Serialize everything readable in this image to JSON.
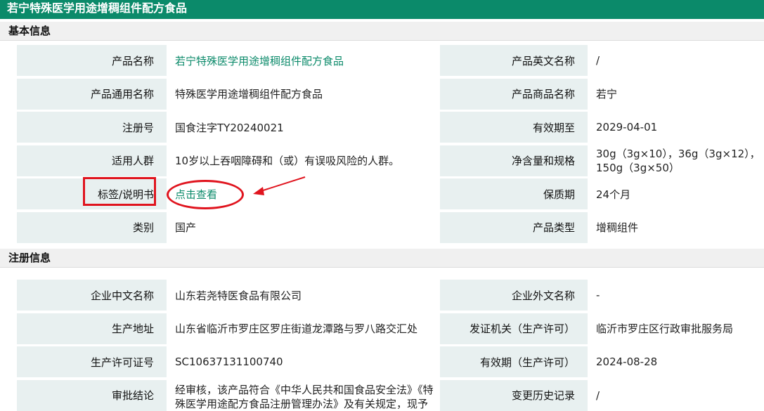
{
  "page_title": "若宁特殊医学用途增稠组件配方食品",
  "sections": {
    "basic": "基本信息",
    "registration": "注册信息"
  },
  "basic_info": {
    "product_name_label": "产品名称",
    "product_name": "若宁特殊医学用途增稠组件配方食品",
    "english_name_label": "产品英文名称",
    "english_name": "/",
    "generic_name_label": "产品通用名称",
    "generic_name": "特殊医学用途增稠组件配方食品",
    "brand_name_label": "产品商品名称",
    "brand_name": "若宁",
    "reg_no_label": "注册号",
    "reg_no": "国食注字TY20240021",
    "valid_until_label": "有效期至",
    "valid_until": "2029-04-01",
    "target_label": "适用人群",
    "target": "10岁以上吞咽障碍和（或）有误吸风险的人群。",
    "net_content_label": "净含量和规格",
    "net_content": "30g（3g×10），36g（3g×12），150g（3g×50）",
    "label_manual_label": "标签/说明书",
    "label_manual_link": "点击查看",
    "shelf_life_label": "保质期",
    "shelf_life": "24个月",
    "category_label": "类别",
    "category": "国产",
    "product_type_label": "产品类型",
    "product_type": "增稠组件"
  },
  "registration_info": {
    "company_cn_label": "企业中文名称",
    "company_cn": "山东若尧特医食品有限公司",
    "company_en_label": "企业外文名称",
    "company_en": "-",
    "address_label": "生产地址",
    "address": "山东省临沂市罗庄区罗庄街道龙潭路与罗八路交汇处",
    "issuer_label": "发证机关（生产许可）",
    "issuer": "临沂市罗庄区行政审批服务局",
    "license_no_label": "生产许可证号",
    "license_no": "SC10637131100740",
    "license_valid_label": "有效期（生产许可）",
    "license_valid": "2024-08-28",
    "conclusion_label": "审批结论",
    "conclusion": "经审核，该产品符合《中华人民共和国食品安全法》《特殊医学用途配方食品注册管理办法》及有关规定，现予批准注册。",
    "history_label": "变更历史记录",
    "history": "/"
  },
  "colors": {
    "header_green": "#0b8a6a",
    "link_green": "#0b8a6a",
    "label_bg": "#e8f0f0",
    "annotation_red": "#e0141e"
  }
}
